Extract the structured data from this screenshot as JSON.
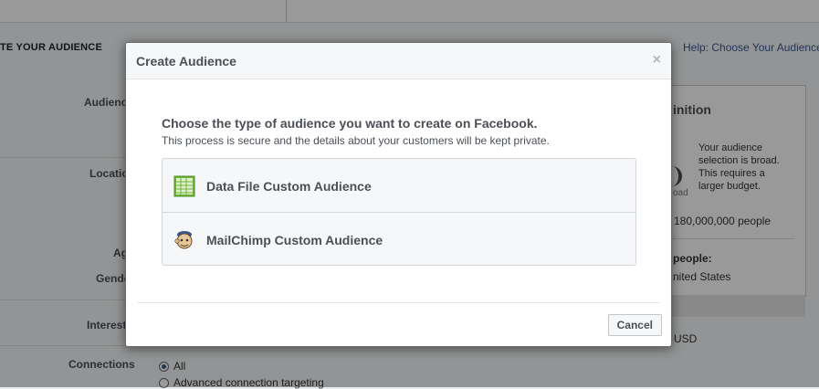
{
  "background": {
    "section_title": "TE YOUR AUDIENCE",
    "help_link": "Help: Choose Your Audience",
    "labels": {
      "audience": "Audienc",
      "locations": "Locatio",
      "age": "Ag",
      "gender": "Gende",
      "interests": "Interest",
      "connections": "Connections"
    },
    "panel": {
      "title": "inition",
      "description": "Your audience selection is broad. This requires a larger budget.",
      "gauge_label": "oad",
      "reach": "180,000,000 people",
      "people_heading": "people:",
      "country": "nited States"
    },
    "currency": "USD",
    "connections": {
      "option_all": "All",
      "option_advanced": "Advanced connection targeting"
    }
  },
  "dialog": {
    "title": "Create Audience",
    "close_glyph": "×",
    "heading": "Choose the type of audience you want to create on Facebook.",
    "subheading": "This process is secure and the details about your customers will be kept private.",
    "options": [
      {
        "label": "Data File Custom Audience",
        "icon": "spreadsheet-icon"
      },
      {
        "label": "MailChimp Custom Audience",
        "icon": "mailchimp-icon"
      }
    ],
    "cancel_label": "Cancel"
  }
}
